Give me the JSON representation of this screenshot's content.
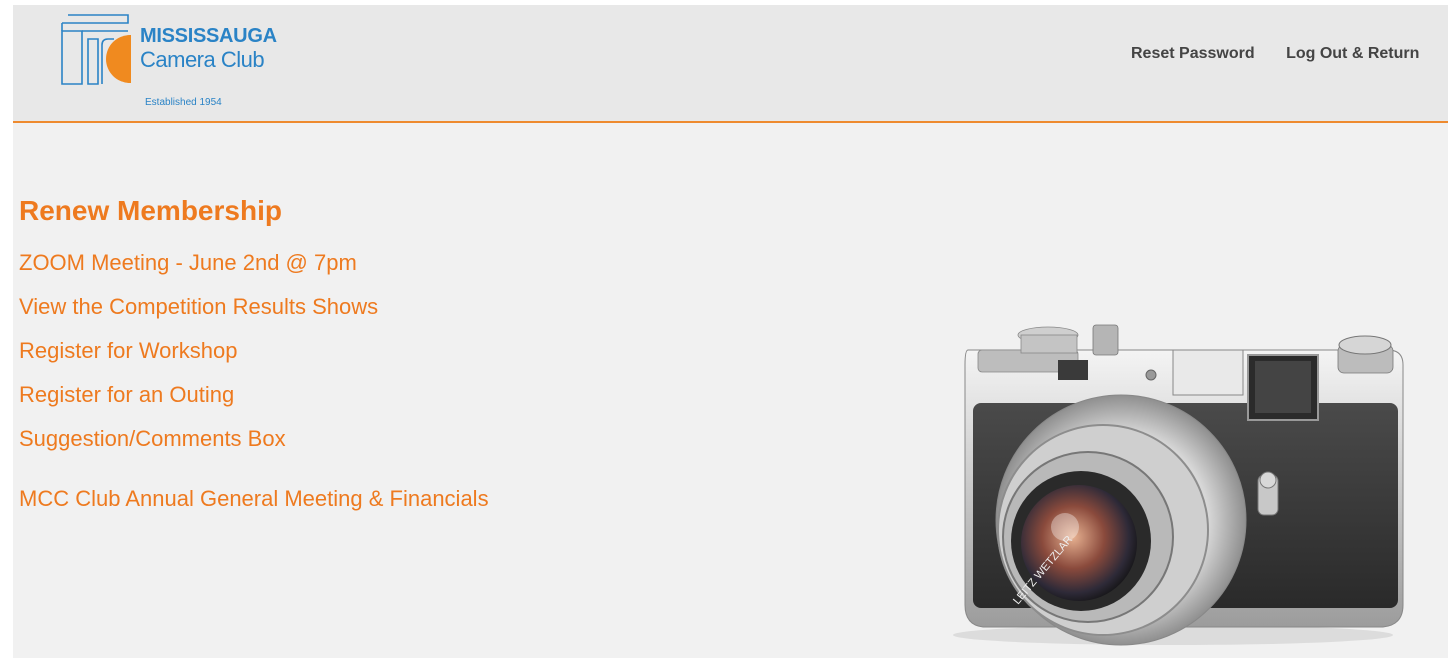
{
  "header": {
    "logo": {
      "line1": "MISSISSAUGA",
      "line2": "Camera Club",
      "established": "Established 1954"
    },
    "nav": [
      {
        "label": "Reset Password"
      },
      {
        "label": "Log Out & Return"
      }
    ]
  },
  "main": {
    "heading": "Renew Membership",
    "links": [
      {
        "label": "ZOOM Meeting - June 2nd @ 7pm"
      },
      {
        "label": "View the Competition Results Shows"
      },
      {
        "label": "Register for Workshop"
      },
      {
        "label": "Register for an Outing"
      },
      {
        "label": "Suggestion/Comments Box"
      },
      {
        "label": "MCC Club Annual General Meeting & Financials"
      }
    ],
    "hero_image": {
      "lens_text": "LEITZ WETZLAR"
    }
  },
  "colors": {
    "accent": "#ee7a1f",
    "brand_blue": "#2a83c6",
    "header_bg": "#e8e8e8",
    "page_bg": "#f1f1f1",
    "nav_text": "#444444"
  }
}
